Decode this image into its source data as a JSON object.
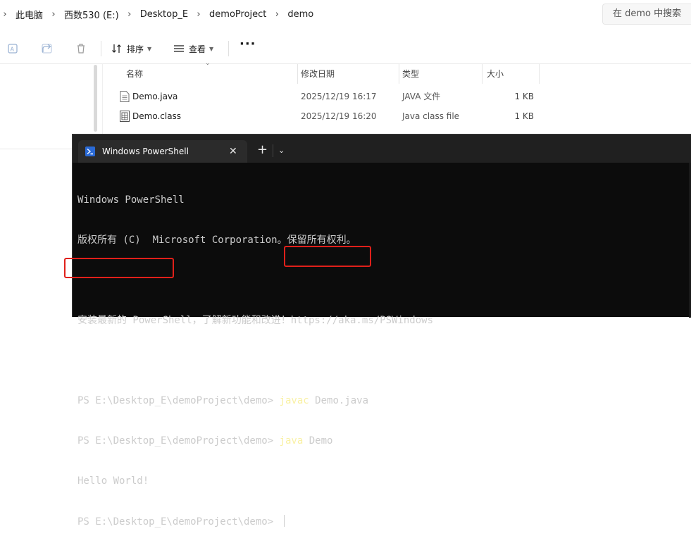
{
  "explorer": {
    "breadcrumbs": [
      "此电脑",
      "西数530 (E:)",
      "Desktop_E",
      "demoProject",
      "demo"
    ],
    "search_placeholder": "在 demo 中搜索",
    "toolbar": {
      "sort_label": "排序",
      "view_label": "查看",
      "more_label": "···"
    },
    "columns": {
      "name": "名称",
      "date": "修改日期",
      "type": "类型",
      "size": "大小"
    },
    "files": [
      {
        "name": "Demo.java",
        "date": "2025/12/19 16:17",
        "type": "JAVA 文件",
        "size": "1 KB",
        "icon": "text-file-icon"
      },
      {
        "name": "Demo.class",
        "date": "2025/12/19 16:20",
        "type": "Java class file",
        "size": "1 KB",
        "icon": "class-file-icon"
      }
    ]
  },
  "terminal": {
    "tab_title": "Windows PowerShell",
    "tab_close": "✕",
    "new_tab": "+",
    "dropdown": "⌄",
    "lines": {
      "l1": "Windows PowerShell",
      "l2": "版权所有 (C)  Microsoft Corporation。保留所有权利。",
      "l3": "安装最新的 PowerShell，了解新功能和改进！https://aka.ms/PSWindows",
      "prompt": "PS E:\\Desktop_E\\demoProject\\demo> ",
      "cmd1_keyword": "javac",
      "cmd1_arg": " Demo.java",
      "cmd2_keyword": "java",
      "cmd2_arg": " Demo",
      "output": "Hello World!"
    }
  },
  "colors": {
    "annotation_red": "#e0201a",
    "terminal_bg": "#0c0c0c",
    "command_yellow": "#f9f1a5"
  }
}
